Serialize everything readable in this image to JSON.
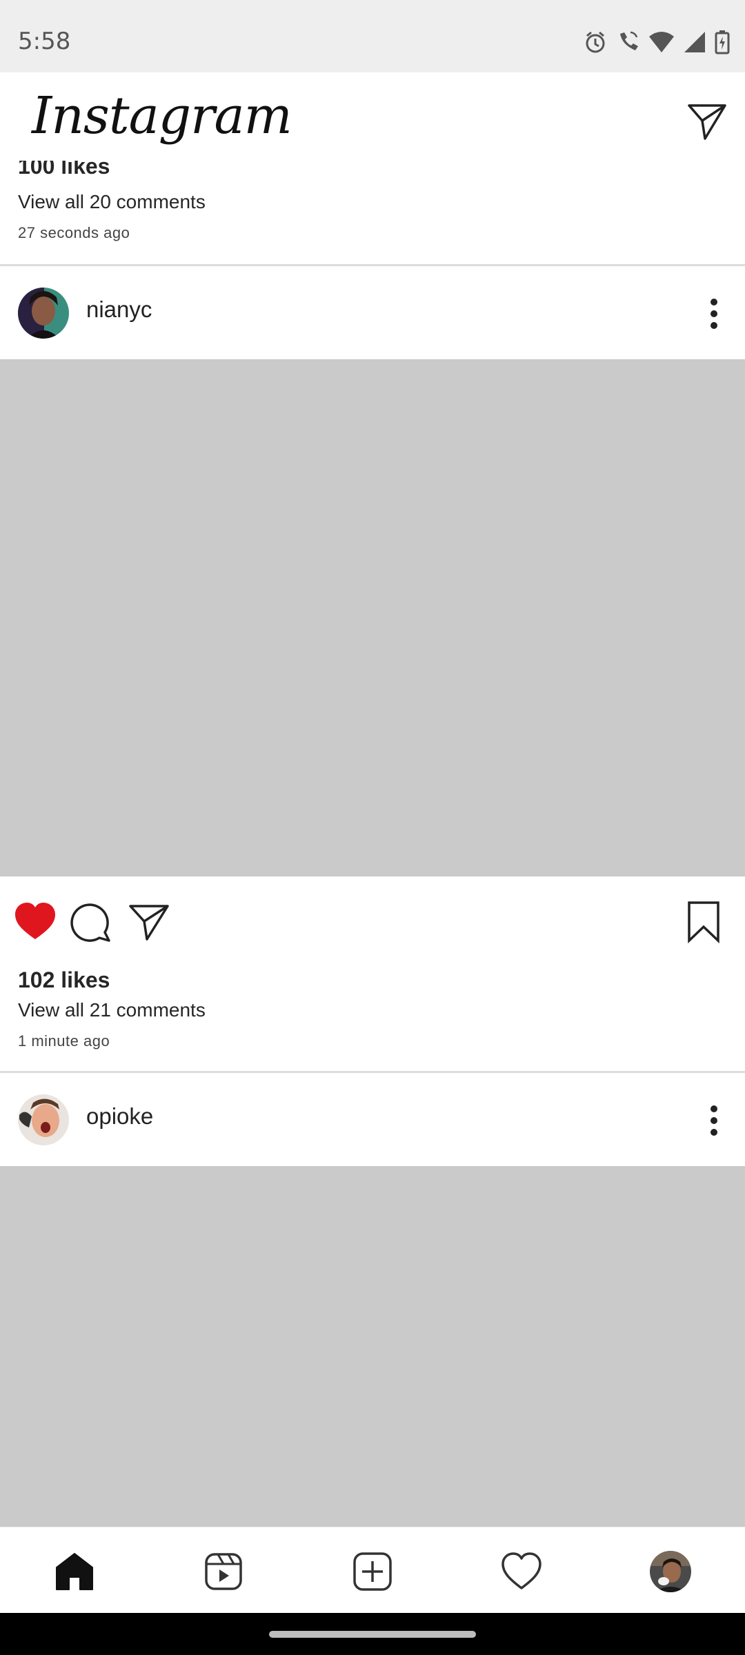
{
  "status_bar": {
    "time": "5:58",
    "icons": [
      "alarm-icon",
      "wifi-calling-icon",
      "wifi-icon",
      "signal-icon",
      "battery-charging-icon"
    ]
  },
  "app": {
    "logo_text": "Instagram",
    "direct_icon": "paper-plane-icon"
  },
  "previous_post": {
    "likes": "100 likes",
    "comments_link": "View all 20 comments",
    "time_ago": "27 seconds ago"
  },
  "posts": [
    {
      "username": "nianyc",
      "avatar": "avatar-nianyc",
      "liked": true,
      "likes": "102 likes",
      "comments_link": "View all 21 comments",
      "time_ago": "1 minute ago"
    },
    {
      "username": "opioke",
      "avatar": "avatar-opioke"
    }
  ],
  "colors": {
    "like_red": "#e0161f",
    "media_placeholder": "#cacaca",
    "status_bar_bg": "#eeeeee"
  },
  "bottom_nav": {
    "items": [
      "home-icon",
      "reels-icon",
      "create-icon",
      "activity-heart-icon",
      "profile-avatar"
    ],
    "selected": "home-icon"
  }
}
